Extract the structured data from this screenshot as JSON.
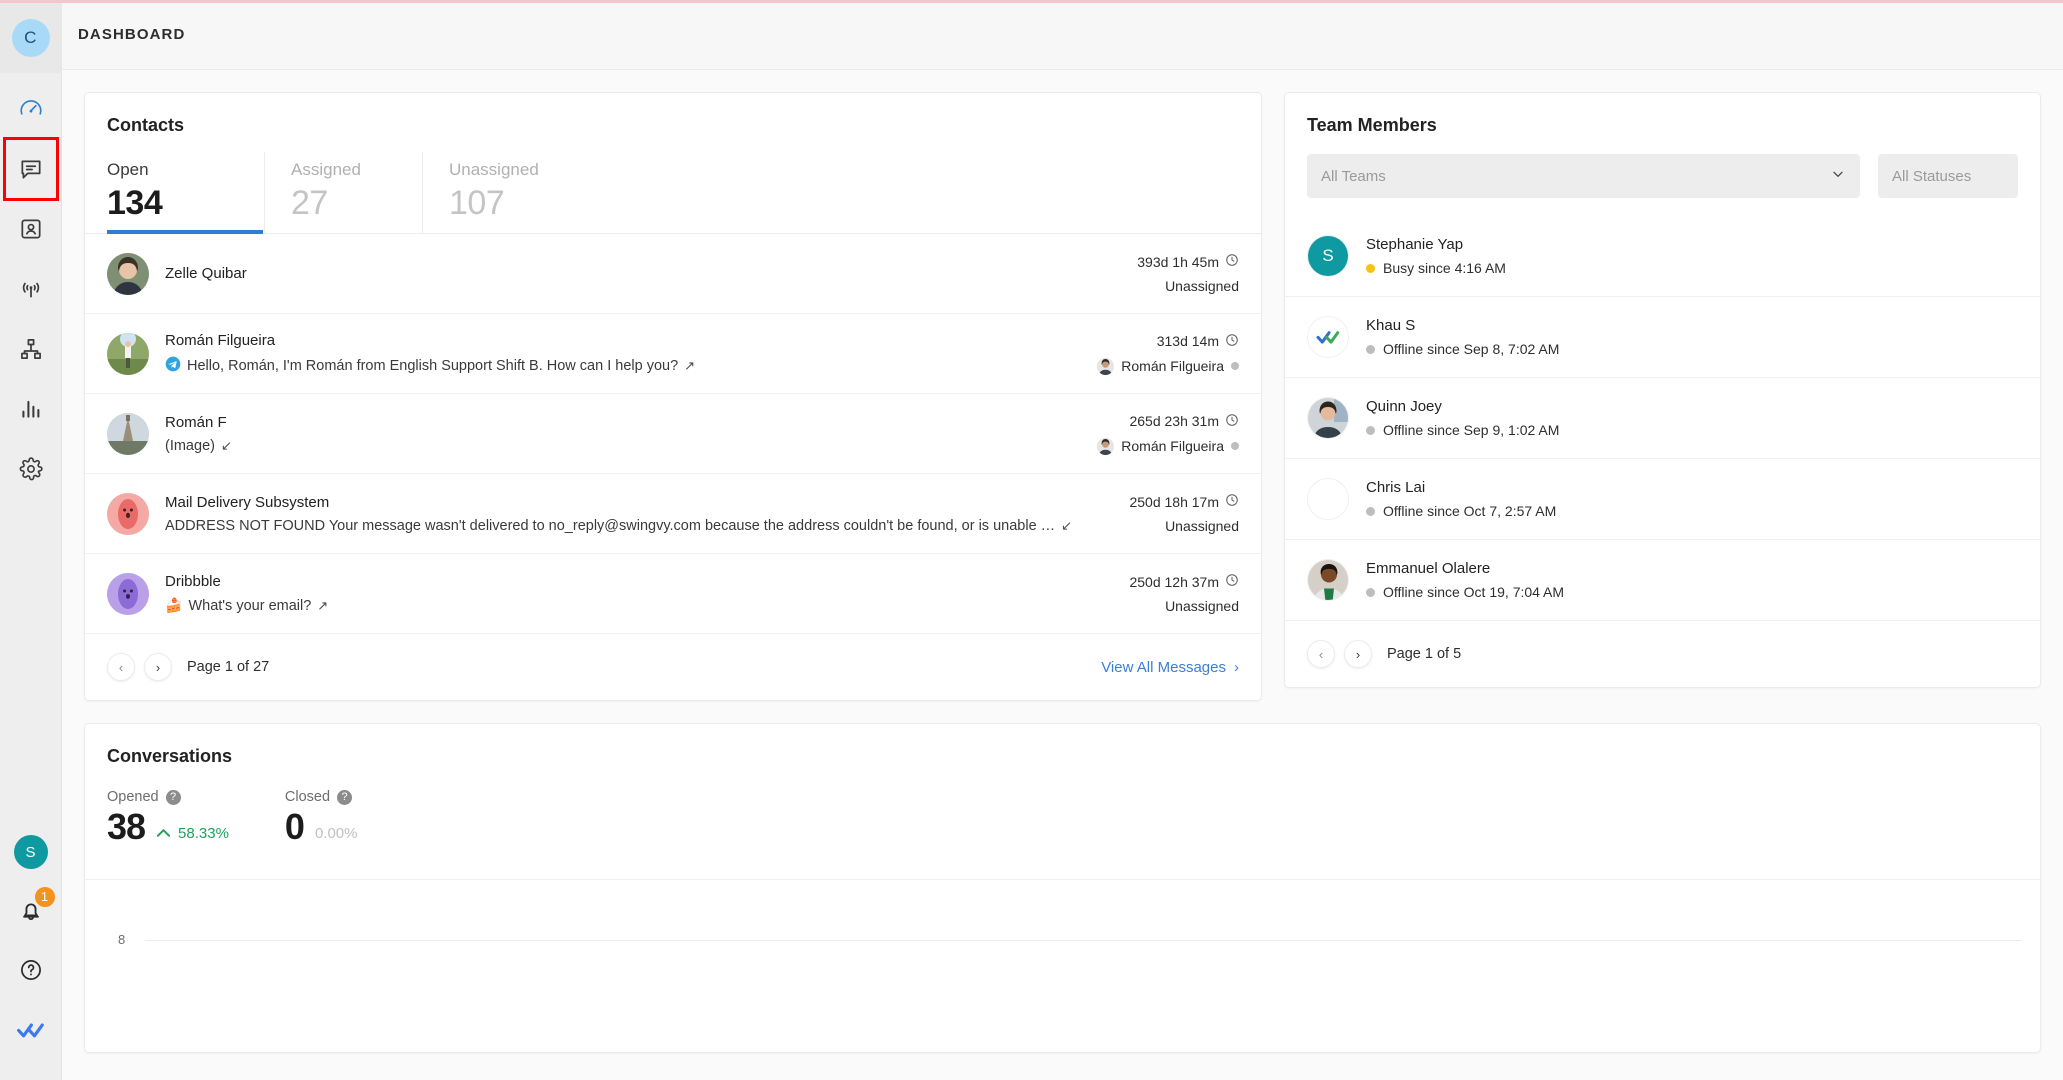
{
  "topbar": {
    "title": "DASHBOARD",
    "workspace_initial": "C"
  },
  "sidebar": {
    "items": [
      {
        "name": "dashboard",
        "icon": "speedometer-icon",
        "selected": false,
        "accent": true
      },
      {
        "name": "messages",
        "icon": "chat-bubble-icon",
        "selected": true,
        "accent": false
      },
      {
        "name": "contacts",
        "icon": "contact-card-icon",
        "selected": false,
        "accent": false
      },
      {
        "name": "broadcasts",
        "icon": "broadcast-antenna-icon",
        "selected": false,
        "accent": false
      },
      {
        "name": "automation",
        "icon": "org-chart-icon",
        "selected": false,
        "accent": false
      },
      {
        "name": "reports",
        "icon": "bar-chart-icon",
        "selected": false,
        "accent": false
      },
      {
        "name": "settings",
        "icon": "gear-icon",
        "selected": false,
        "accent": false
      }
    ],
    "user_initial": "S",
    "notification_count": "1"
  },
  "contacts": {
    "title": "Contacts",
    "tabs": [
      {
        "label": "Open",
        "value": "134",
        "active": true
      },
      {
        "label": "Assigned",
        "value": "27",
        "active": false
      },
      {
        "label": "Unassigned",
        "value": "107",
        "active": false
      }
    ],
    "rows": [
      {
        "name": "Zelle Quibar",
        "message": "",
        "channel_icon": "",
        "direction_icon": "",
        "time": "393d 1h 45m",
        "assignee": "Unassigned",
        "assignee_has_avatar": false,
        "avatar_kind": "photo-woman-1"
      },
      {
        "name": "Román Filgueira",
        "message": "Hello, Román, I'm Román from English Support Shift B. How can I help you?",
        "channel_icon": "telegram-icon",
        "direction_icon": "arrow-outgoing-icon",
        "time": "313d 14m",
        "assignee": "Román Filgueira",
        "assignee_has_avatar": true,
        "avatar_kind": "photo-outdoor"
      },
      {
        "name": "Román F",
        "message": "(Image)",
        "channel_icon": "",
        "direction_icon": "arrow-incoming-icon",
        "time": "265d 23h 31m",
        "assignee": "Román Filgueira",
        "assignee_has_avatar": true,
        "avatar_kind": "photo-tower"
      },
      {
        "name": "Mail Delivery Subsystem",
        "message": "ADDRESS NOT FOUND Your message wasn't delivered to no_reply@swingvy.com because the address couldn't be found, or is unable …",
        "channel_icon": "",
        "direction_icon": "arrow-incoming-icon",
        "time": "250d 18h 17m",
        "assignee": "Unassigned",
        "assignee_has_avatar": false,
        "avatar_kind": "blob-red"
      },
      {
        "name": "Dribbble",
        "message": "What's your email?",
        "channel_icon": "cupcake-icon",
        "direction_icon": "arrow-outgoing-icon",
        "time": "250d 12h 37m",
        "assignee": "Unassigned",
        "assignee_has_avatar": false,
        "avatar_kind": "blob-purple"
      }
    ],
    "pagination": "Page 1 of 27",
    "view_all_label": "View All Messages"
  },
  "team": {
    "title": "Team Members",
    "filter_team": "All Teams",
    "filter_status": "All Statuses",
    "members": [
      {
        "name": "Stephanie Yap",
        "status": "Busy since 4:16 AM",
        "status_color": "#f5c211",
        "avatar_kind": "initial-teal",
        "initial": "S"
      },
      {
        "name": "Khau S",
        "status": "Offline since Sep 8, 7:02 AM",
        "status_color": "#bdbdbd",
        "avatar_kind": "logo-check",
        "initial": ""
      },
      {
        "name": "Quinn Joey",
        "status": "Offline since Sep 9, 1:02 AM",
        "status_color": "#bdbdbd",
        "avatar_kind": "photo-woman-2",
        "initial": ""
      },
      {
        "name": "Chris Lai",
        "status": "Offline since Oct 7, 2:57 AM",
        "status_color": "#bdbdbd",
        "avatar_kind": "empty",
        "initial": ""
      },
      {
        "name": "Emmanuel Olalere",
        "status": "Offline since Oct 19, 7:04 AM",
        "status_color": "#bdbdbd",
        "avatar_kind": "photo-man",
        "initial": ""
      }
    ],
    "pagination": "Page 1 of 5"
  },
  "conversations": {
    "title": "Conversations",
    "opened_label": "Opened",
    "opened_value": "38",
    "opened_delta": "58.33%",
    "closed_label": "Closed",
    "closed_value": "0",
    "closed_delta": "0.00%"
  },
  "chart_data": {
    "type": "line",
    "title": "Conversations",
    "x": [],
    "series": [
      {
        "name": "Opened",
        "values": []
      },
      {
        "name": "Closed",
        "values": []
      }
    ],
    "yticks": [
      "8"
    ],
    "ylim": [
      0,
      8
    ],
    "grid": true,
    "note": "chart is cropped at the bottom edge of the screenshot; only the y-axis tick 8 and its gridline are visible"
  },
  "colors": {
    "accent_blue": "#2f7fd1",
    "link_blue": "#3a7fd5",
    "positive_green": "#20a05e",
    "busy_yellow": "#f5c211",
    "badge_orange": "#f5921e",
    "teal_avatar": "#0e9aa0",
    "selection_red": "#ff0000"
  }
}
